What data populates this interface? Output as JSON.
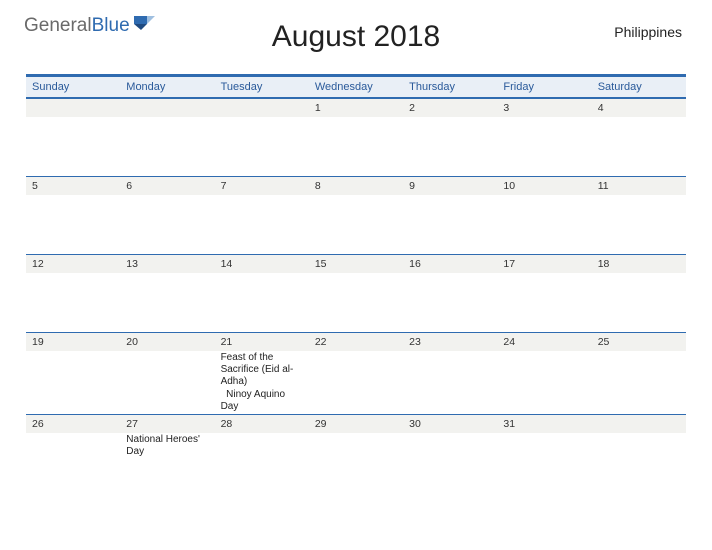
{
  "brand": {
    "word1": "General",
    "word2": "Blue"
  },
  "title": "August 2018",
  "country": "Philippines",
  "dayNames": [
    "Sunday",
    "Monday",
    "Tuesday",
    "Wednesday",
    "Thursday",
    "Friday",
    "Saturday"
  ],
  "weeks": [
    [
      {
        "num": ""
      },
      {
        "num": ""
      },
      {
        "num": ""
      },
      {
        "num": "1"
      },
      {
        "num": "2"
      },
      {
        "num": "3"
      },
      {
        "num": "4"
      }
    ],
    [
      {
        "num": "5"
      },
      {
        "num": "6"
      },
      {
        "num": "7"
      },
      {
        "num": "8"
      },
      {
        "num": "9"
      },
      {
        "num": "10"
      },
      {
        "num": "11"
      }
    ],
    [
      {
        "num": "12"
      },
      {
        "num": "13"
      },
      {
        "num": "14"
      },
      {
        "num": "15"
      },
      {
        "num": "16"
      },
      {
        "num": "17"
      },
      {
        "num": "18"
      }
    ],
    [
      {
        "num": "19"
      },
      {
        "num": "20"
      },
      {
        "num": "21",
        "events": [
          "Feast of the Sacrifice (Eid al-Adha)",
          "  Ninoy Aquino Day"
        ]
      },
      {
        "num": "22"
      },
      {
        "num": "23"
      },
      {
        "num": "24"
      },
      {
        "num": "25"
      }
    ],
    [
      {
        "num": "26"
      },
      {
        "num": "27",
        "events": [
          "National Heroes' Day"
        ]
      },
      {
        "num": "28"
      },
      {
        "num": "29"
      },
      {
        "num": "30"
      },
      {
        "num": "31"
      },
      {
        "num": ""
      }
    ]
  ]
}
